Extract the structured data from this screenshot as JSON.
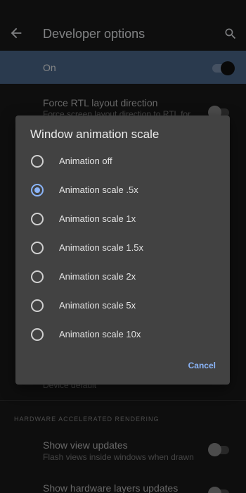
{
  "header": {
    "title": "Developer options"
  },
  "master_toggle": {
    "label": "On",
    "state": "on"
  },
  "background_items": [
    {
      "title": "Force RTL layout direction",
      "subtitle": "Force screen layout direction to RTL for"
    },
    {
      "title": "",
      "subtitle": "Device default"
    }
  ],
  "section": {
    "hardware_header": "HARDWARE ACCELERATED RENDERING"
  },
  "hardware_items": [
    {
      "title": "Show view updates",
      "subtitle": "Flash views inside windows when drawn"
    },
    {
      "title": "Show hardware layers updates",
      "subtitle": ""
    }
  ],
  "dialog": {
    "title": "Window animation scale",
    "options": [
      {
        "label": "Animation off"
      },
      {
        "label": "Animation scale .5x"
      },
      {
        "label": "Animation scale 1x"
      },
      {
        "label": "Animation scale 1.5x"
      },
      {
        "label": "Animation scale 2x"
      },
      {
        "label": "Animation scale 5x"
      },
      {
        "label": "Animation scale 10x"
      }
    ],
    "selected_index": 1,
    "cancel_label": "Cancel"
  },
  "colors": {
    "accent": "#8ab4f8",
    "master_row": "#4d6a8f",
    "background": "#1b1b1b",
    "dialog": "#424242"
  },
  "icons": {
    "back": "arrow-back-icon",
    "search": "search-icon"
  }
}
